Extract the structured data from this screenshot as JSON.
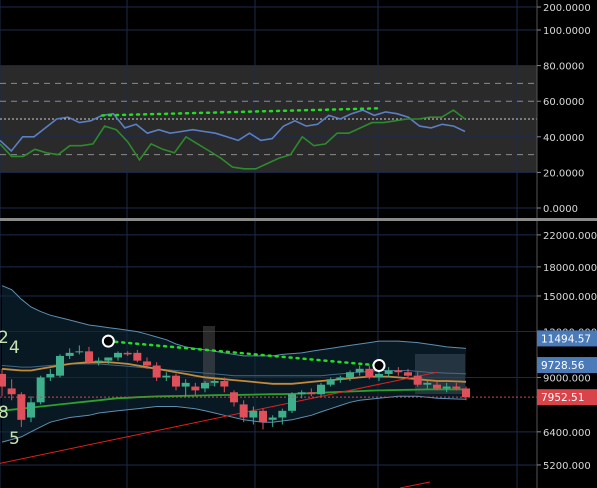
{
  "chart_data": [
    {
      "panel": "oscillator",
      "type": "line",
      "ylim": [
        0,
        200
      ],
      "y_ticks": [
        "200.0000",
        "100.0000",
        "80.0000",
        "60.0000",
        "40.0000",
        "20.0000",
        "0.0000"
      ],
      "levels": [
        70,
        60,
        50,
        30
      ],
      "band": [
        20,
        80
      ],
      "grid": true,
      "series": [
        {
          "color": "#5b7fc4",
          "values": [
            38,
            32,
            40,
            40,
            45,
            50,
            51,
            48,
            49,
            52,
            53,
            45,
            47,
            42,
            44,
            42,
            43,
            44,
            43,
            42,
            40,
            38,
            42,
            38,
            39,
            46,
            49,
            46,
            47,
            52,
            50,
            53,
            55,
            52,
            54,
            53,
            51,
            46,
            45,
            47,
            46,
            43
          ]
        },
        {
          "color": "#2d8a2d",
          "values": [
            36,
            29,
            29,
            33,
            31,
            30,
            35,
            35,
            36,
            46,
            44,
            37,
            27,
            36,
            33,
            31,
            40,
            36,
            32,
            28,
            23,
            22,
            22,
            25,
            28,
            30,
            40,
            35,
            36,
            42,
            42,
            45,
            48,
            48,
            49,
            50,
            50,
            51,
            51,
            55,
            50
          ]
        }
      ],
      "divergence_line": {
        "color": "#22dd22",
        "x": [
          9,
          33
        ],
        "y": [
          52,
          56
        ]
      }
    },
    {
      "panel": "price",
      "type": "candlestick",
      "y_scale": "log",
      "ylim": [
        4500,
        24000
      ],
      "y_ticks": [
        "22000.000",
        "18000.000",
        "15000.000",
        "12000.000",
        "9000.000",
        "6400.000",
        "5200.000"
      ],
      "price_labels": [
        {
          "text": "11494.57",
          "value": 11494.57,
          "color": "#4a7ab8"
        },
        {
          "text": "9728.56",
          "value": 9728.56,
          "color": "#4a7ab8"
        },
        {
          "text": "7952.51",
          "value": 7952.51,
          "color": "#d9434a"
        }
      ],
      "wave_labels": [
        "2",
        "4",
        "8",
        "5"
      ],
      "candles": [
        [
          9200,
          9500,
          8000,
          8500
        ],
        [
          8400,
          8900,
          7800,
          8100
        ],
        [
          8100,
          8200,
          6600,
          6900
        ],
        [
          7000,
          8000,
          6800,
          7700
        ],
        [
          7700,
          9100,
          7600,
          9000
        ],
        [
          9000,
          9500,
          8800,
          9200
        ],
        [
          9100,
          10400,
          9000,
          10300
        ],
        [
          10300,
          10800,
          10100,
          10500
        ],
        [
          10600,
          11000,
          10400,
          10600
        ],
        [
          10600,
          10900,
          9800,
          9900
        ],
        [
          9900,
          10200,
          9700,
          10000
        ],
        [
          10000,
          10200,
          9800,
          10200
        ],
        [
          10200,
          10600,
          10000,
          10500
        ],
        [
          10500,
          10600,
          10300,
          10400
        ],
        [
          10500,
          10700,
          9900,
          10000
        ],
        [
          9950,
          10200,
          9500,
          9700
        ],
        [
          9700,
          9900,
          8800,
          9000
        ],
        [
          9000,
          9300,
          8800,
          9100
        ],
        [
          9100,
          9200,
          8300,
          8500
        ],
        [
          8500,
          8900,
          8000,
          8700
        ],
        [
          8500,
          8700,
          8000,
          8300
        ],
        [
          8400,
          8800,
          8200,
          8700
        ],
        [
          8700,
          8900,
          8500,
          8800
        ],
        [
          8800,
          9000,
          8200,
          8500
        ],
        [
          8200,
          8300,
          7500,
          7700
        ],
        [
          7600,
          7800,
          6800,
          7000
        ],
        [
          7000,
          7500,
          6700,
          7300
        ],
        [
          7300,
          7400,
          6500,
          6800
        ],
        [
          6900,
          7100,
          6600,
          7000
        ],
        [
          7000,
          7400,
          6700,
          7300
        ],
        [
          7300,
          8200,
          7200,
          8100
        ],
        [
          8100,
          8300,
          7900,
          8200
        ],
        [
          8200,
          8400,
          8000,
          8100
        ],
        [
          8100,
          8700,
          8000,
          8600
        ],
        [
          8600,
          9000,
          8500,
          8900
        ],
        [
          8900,
          9100,
          8700,
          9000
        ],
        [
          9000,
          9400,
          8800,
          9300
        ],
        [
          9300,
          9700,
          9100,
          9500
        ],
        [
          9500,
          9700,
          8900,
          9000
        ],
        [
          9000,
          9400,
          8800,
          9200
        ],
        [
          9200,
          9600,
          9000,
          9400
        ],
        [
          9400,
          9600,
          9100,
          9300
        ],
        [
          9300,
          9500,
          9000,
          9100
        ],
        [
          9100,
          9300,
          8500,
          8600
        ],
        [
          8600,
          8900,
          8400,
          8700
        ],
        [
          8600,
          8800,
          8300,
          8400
        ],
        [
          8400,
          8700,
          8200,
          8500
        ],
        [
          8500,
          8700,
          8300,
          8400
        ],
        [
          8400,
          8500,
          7800,
          7950
        ]
      ],
      "bollinger": {
        "upper": [
          16000,
          15600,
          14700,
          14000,
          13600,
          13300,
          13100,
          12900,
          12700,
          12500,
          12400,
          12300,
          12200,
          12100,
          12000,
          11800,
          11600,
          11400,
          11100,
          10900,
          10800,
          10700,
          10600,
          10500,
          10400,
          10300,
          10300,
          10300,
          10300,
          10400,
          10450,
          10500,
          10600,
          10700,
          10800,
          10900,
          11000,
          11100,
          11200,
          11300,
          11300,
          11300,
          11250,
          11200,
          11100,
          11000,
          10900,
          10850,
          10800
        ],
        "middle": [
          9700,
          9650,
          9600,
          9600,
          9650,
          9700,
          9750,
          9800,
          9800,
          9800,
          9800,
          9750,
          9700,
          9650,
          9600,
          9550,
          9500,
          9450,
          9400,
          9350,
          9300,
          9250,
          9200,
          9150,
          9100,
          9100,
          9100,
          9100,
          9100,
          9100,
          9100,
          9100,
          9100,
          9100,
          9150,
          9200,
          9250,
          9300,
          9350,
          9400,
          9400,
          9400,
          9400,
          9350,
          9300,
          9280,
          9250,
          9230,
          9200
        ],
        "lower": [
          6000,
          6100,
          6200,
          6400,
          6600,
          6800,
          6900,
          7000,
          7050,
          7100,
          7200,
          7250,
          7300,
          7350,
          7400,
          7450,
          7500,
          7500,
          7500,
          7450,
          7400,
          7300,
          7200,
          7100,
          7000,
          6900,
          6850,
          6800,
          6800,
          6850,
          6900,
          7000,
          7100,
          7250,
          7400,
          7550,
          7700,
          7800,
          7850,
          7900,
          7950,
          8000,
          8000,
          8000,
          7950,
          7900,
          7880,
          7860,
          7850
        ]
      },
      "ma_orange": {
        "color": "#c48a3a",
        "values": [
          9500,
          9450,
          9400,
          9400,
          9500,
          9600,
          9700,
          9800,
          9850,
          9900,
          9900,
          9900,
          9850,
          9800,
          9700,
          9600,
          9500,
          9400,
          9300,
          9200,
          9100,
          9000,
          8950,
          8900,
          8850,
          8800,
          8750,
          8700,
          8650,
          8650,
          8650,
          8700,
          8750,
          8800,
          8850,
          8900,
          8950,
          9000,
          9050,
          9050,
          9050,
          9000,
          8950,
          8900,
          8850,
          8800,
          8800,
          8780,
          8760
        ]
      },
      "ma_green": {
        "color": "#2da02d",
        "values": [
          7300,
          7350,
          7400,
          7450,
          7500,
          7550,
          7600,
          7650,
          7700,
          7750,
          7800,
          7850,
          7900,
          7920,
          7950,
          7970,
          7990,
          8000,
          8010,
          8020,
          8030,
          8040,
          8050,
          8060,
          8060,
          8070,
          8080,
          8090,
          8100,
          8110,
          8120,
          8140,
          8160,
          8180,
          8200,
          8220,
          8240,
          8260,
          8280,
          8300,
          8310,
          8320,
          8330,
          8340,
          8350,
          8350,
          8350,
          8350,
          8350
        ]
      },
      "trendline": {
        "color": "#e02020",
        "points": [
          [
            -1,
            5200
          ],
          [
            45,
            9300
          ]
        ]
      },
      "divergence_line": {
        "color": "#22dd22",
        "points": [
          [
            11,
            11300
          ],
          [
            39,
            9700
          ]
        ]
      },
      "pivot_markers": [
        [
          11,
          11300
        ],
        [
          39,
          9700
        ]
      ],
      "grid": true
    }
  ]
}
